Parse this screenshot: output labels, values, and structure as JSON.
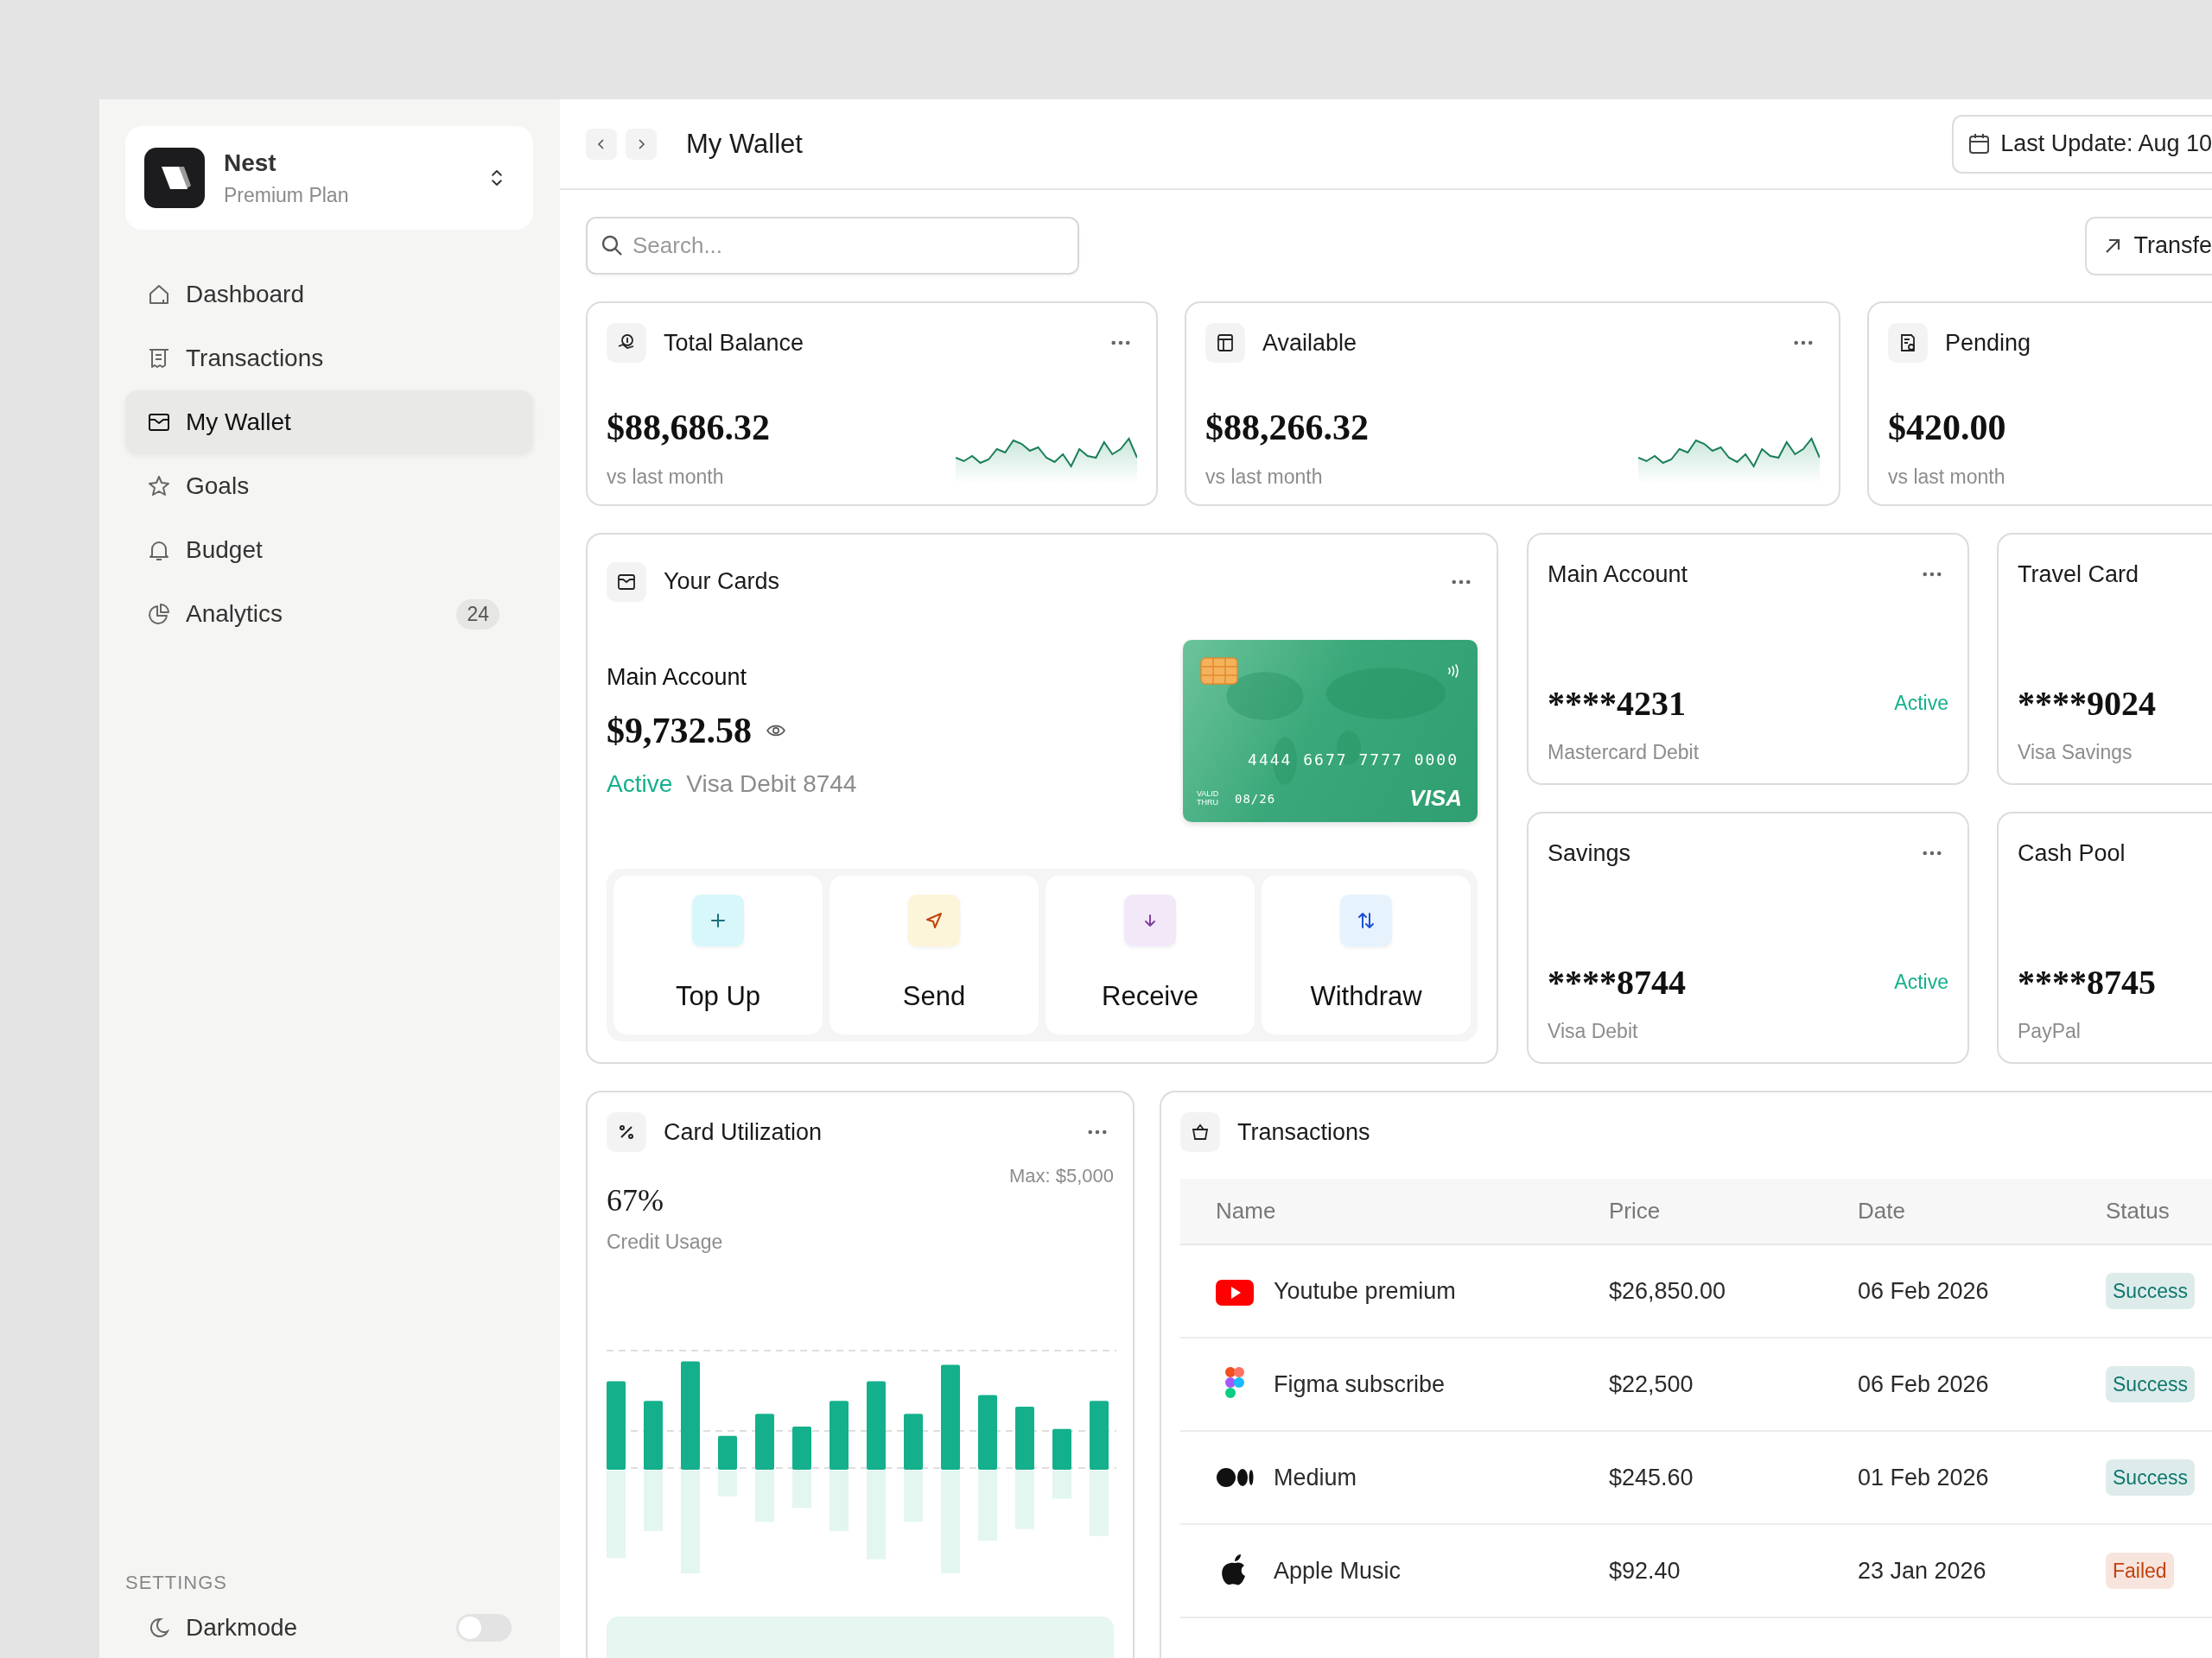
{
  "brand": {
    "name": "Nest",
    "plan": "Premium Plan"
  },
  "sidebar": {
    "items": [
      {
        "label": "Dashboard",
        "selected": false
      },
      {
        "label": "Transactions",
        "selected": false
      },
      {
        "label": "My Wallet",
        "selected": true
      },
      {
        "label": "Goals",
        "selected": false
      },
      {
        "label": "Budget",
        "selected": false
      },
      {
        "label": "Analytics",
        "selected": false,
        "badge": "24"
      }
    ],
    "settings_heading": "SETTINGS",
    "settings": [
      {
        "label": "Darkmode",
        "on": false
      }
    ]
  },
  "header": {
    "title": "My Wallet",
    "last_update": "Last Update: Aug 10"
  },
  "search": {
    "placeholder": "Search..."
  },
  "transfer_button": "Transfe",
  "stats": [
    {
      "title": "Total Balance",
      "value": "$88,686.32",
      "note": "vs last month",
      "sparkline": true,
      "menu": true
    },
    {
      "title": "Available",
      "value": "$88,266.32",
      "note": "vs last month",
      "sparkline": true,
      "menu": true
    },
    {
      "title": "Pending",
      "value": "$420.00",
      "note": "vs last month",
      "sparkline": false,
      "menu": false
    }
  ],
  "your_cards": {
    "title": "Your Cards",
    "account": "Main Account",
    "balance": "$9,732.58",
    "status": "Active",
    "card_label": "Visa Debit 8744",
    "card": {
      "number": "4444 6677 7777 0000",
      "valid_label": "VALID THRU",
      "expiry": "08/26",
      "network": "VISA"
    },
    "actions": [
      "Top Up",
      "Send",
      "Receive",
      "Withdraw"
    ]
  },
  "accounts": [
    {
      "title": "Main Account",
      "number": "****4231",
      "status": "Active",
      "type": "Mastercard Debit",
      "menu": true
    },
    {
      "title": "Travel Card",
      "number": "****9024",
      "type": "Visa Savings",
      "menu": false
    },
    {
      "title": "Savings",
      "number": "****8744",
      "status": "Active",
      "type": "Visa Debit",
      "menu": true
    },
    {
      "title": "Cash Pool",
      "number": "****8745",
      "type": "PayPal",
      "menu": false
    }
  ],
  "utilization": {
    "title": "Card Utilization",
    "value": "67%",
    "label": "Credit Usage",
    "max": "Max: $5,000"
  },
  "transactions": {
    "title": "Transactions",
    "columns": [
      "Name",
      "Price",
      "Date",
      "Status"
    ],
    "rows": [
      {
        "name": "Youtube premium",
        "price": "$26,850.00",
        "date": "06 Feb 2026",
        "status": "Success",
        "color": "#0f766e"
      },
      {
        "name": "Figma subscribe",
        "price": "$22,500",
        "date": "06 Feb 2026",
        "status": "Success",
        "color": "#0f766e"
      },
      {
        "name": "Medium",
        "price": "$245.60",
        "date": "01 Feb 2026",
        "status": "Success",
        "color": "#0f766e"
      },
      {
        "name": "Apple Music",
        "price": "$92.40",
        "date": "23 Jan 2026",
        "status": "Failed",
        "color": "#c2410c"
      }
    ]
  }
}
